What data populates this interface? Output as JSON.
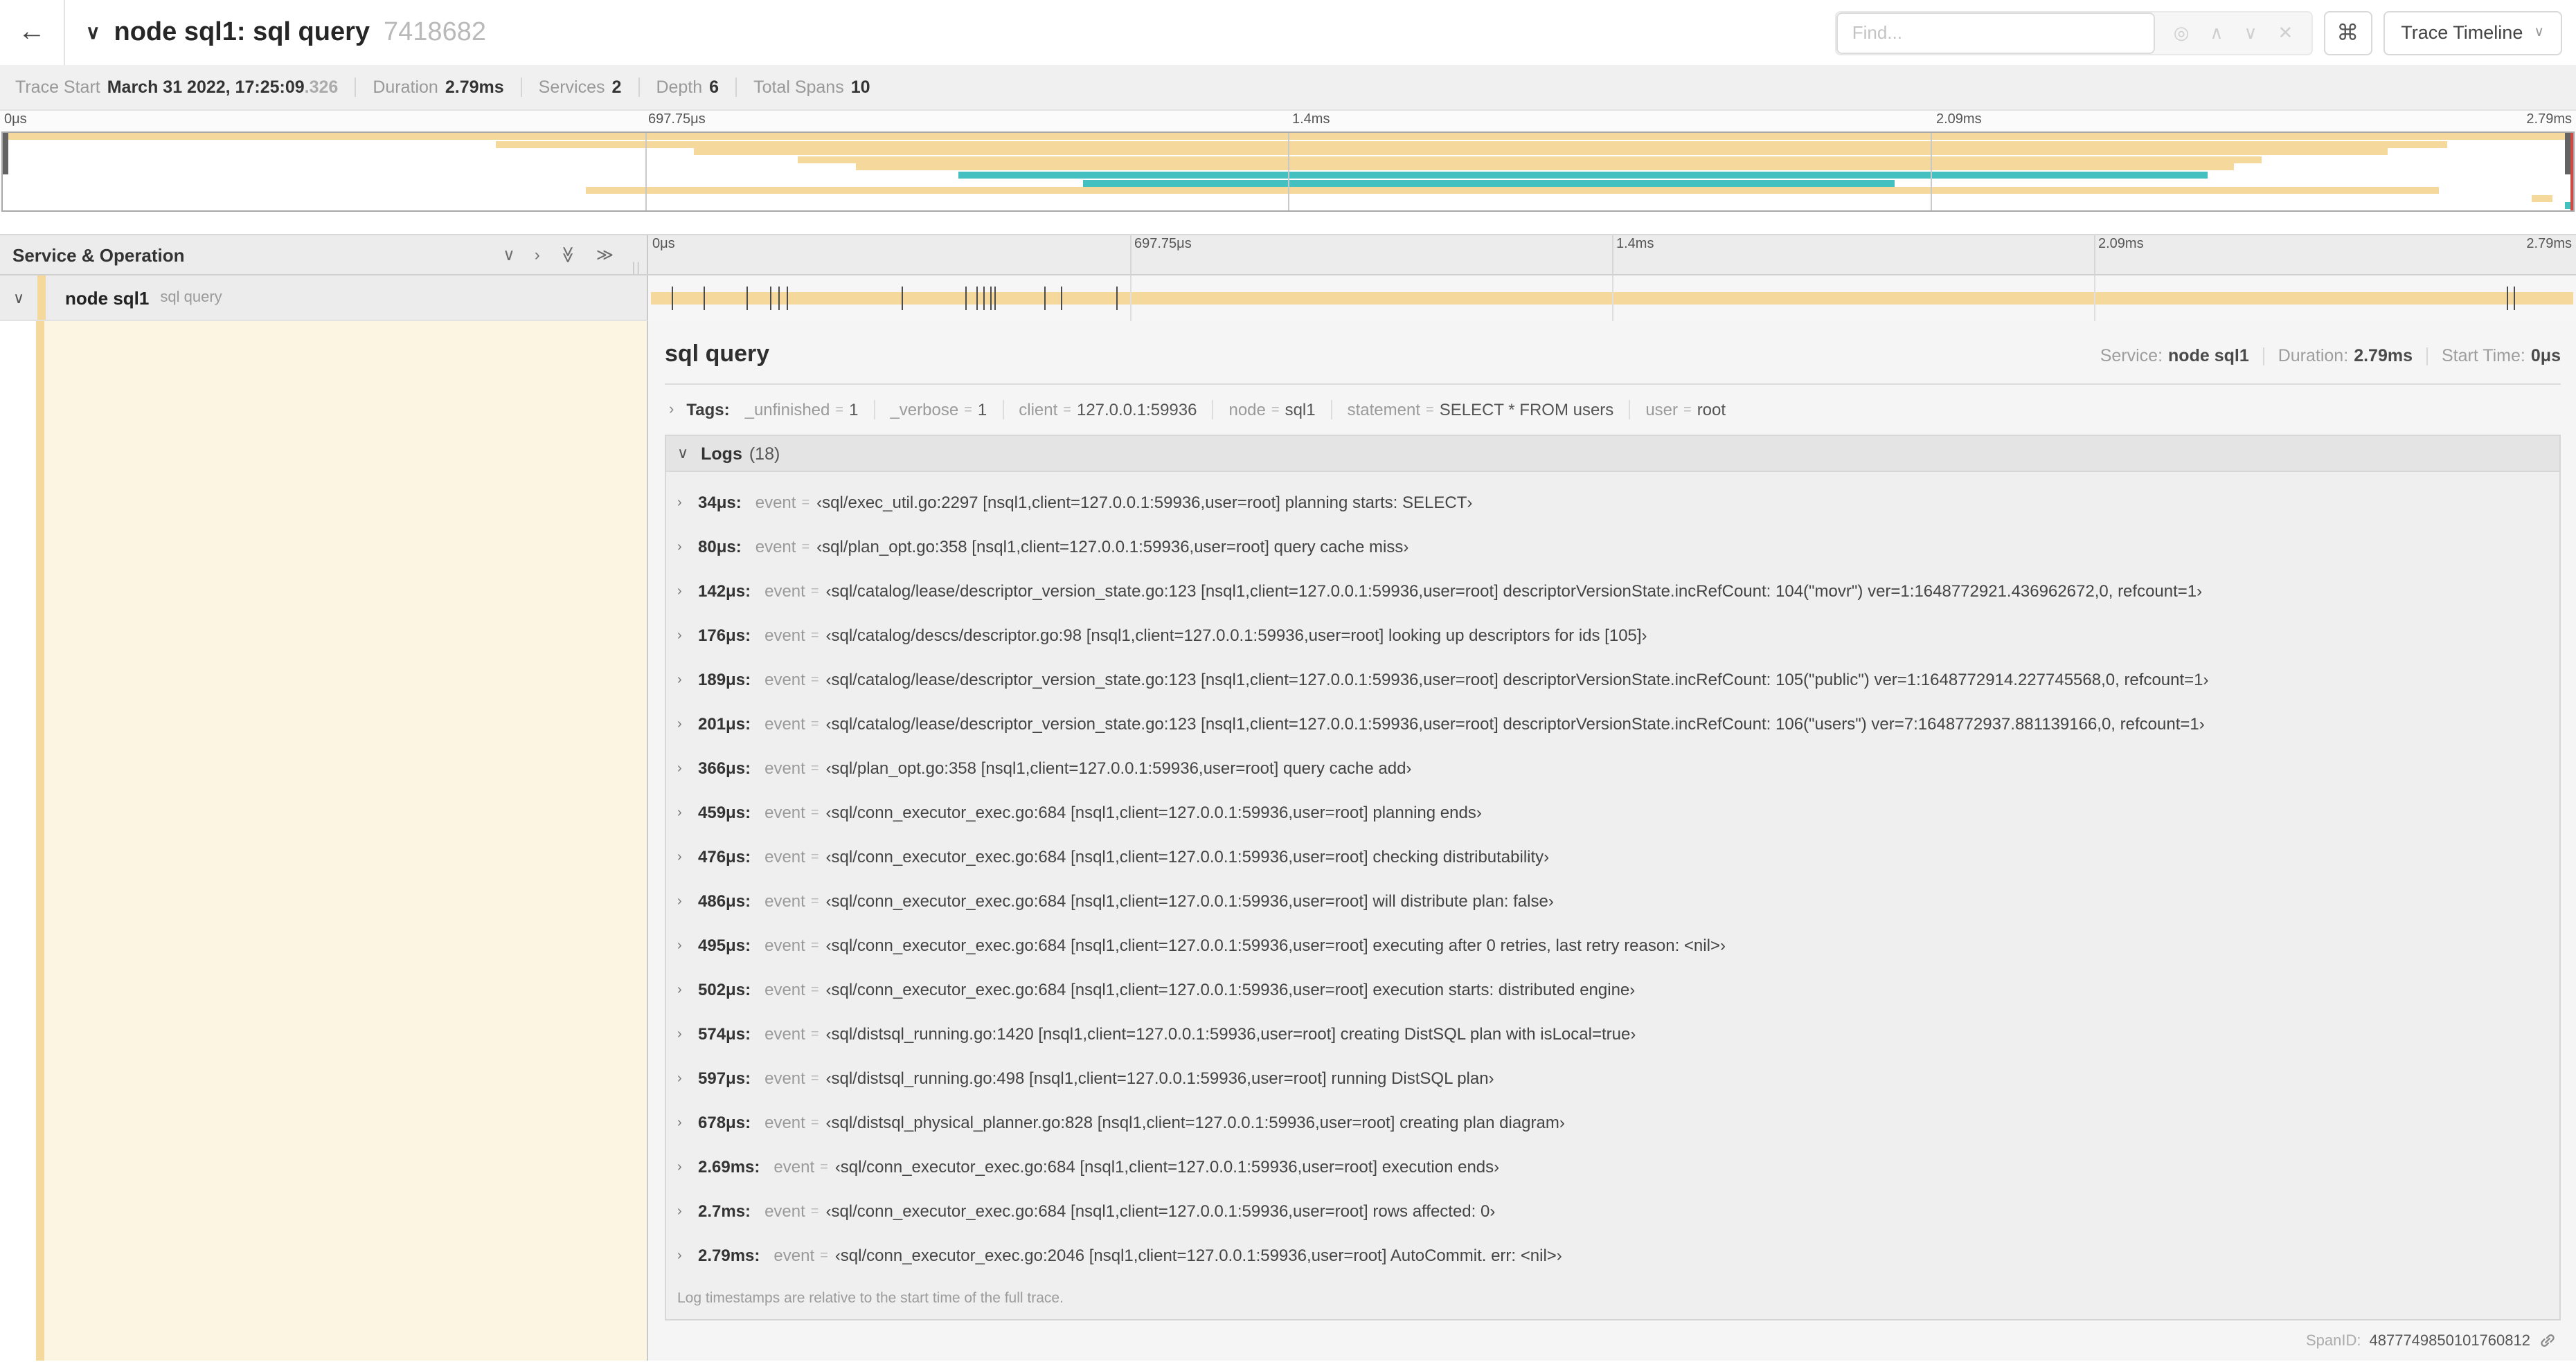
{
  "icons": {
    "back_arrow": "←",
    "chevron_down": "∨",
    "chevron_right": "›",
    "chevron_up": "∧",
    "double_chevron": "≫",
    "target": "◎",
    "close": "✕",
    "command": "⌘",
    "grip": "||"
  },
  "colors": {
    "span_tan": "#F5D99C",
    "span_teal": "#44C0C0",
    "detail_cream": "#FCF5E2",
    "minimap_end_marker": "#CF4A44"
  },
  "topbar": {
    "title": "node sql1: sql query",
    "trace_id_short": "7418682",
    "find_placeholder": "Find...",
    "view_button_label": "Trace Timeline"
  },
  "tracebar": {
    "items": [
      {
        "label": "Trace Start",
        "value": "March 31 2022, 17:25:09",
        "suffix": ".326"
      },
      {
        "label": "Duration",
        "value": "2.79ms"
      },
      {
        "label": "Services",
        "value": "2"
      },
      {
        "label": "Depth",
        "value": "6"
      },
      {
        "label": "Total Spans",
        "value": "10"
      }
    ]
  },
  "trace": {
    "duration_us": 2790
  },
  "ruler": {
    "ticks": [
      {
        "label": "0μs",
        "pct": 0
      },
      {
        "label": "697.75μs",
        "pct": 25
      },
      {
        "label": "1.4ms",
        "pct": 50
      },
      {
        "label": "2.09ms",
        "pct": 75
      },
      {
        "label": "2.79ms",
        "pct": 100
      }
    ],
    "grid_pcts": [
      25,
      50,
      75
    ]
  },
  "minimap": {
    "rows": [
      {
        "color": "tan",
        "start": 0,
        "end": 100
      },
      {
        "color": "tan",
        "start": 19.2,
        "end": 95.1
      },
      {
        "color": "tan",
        "start": 26.9,
        "end": 92.8
      },
      {
        "color": "tan",
        "start": 30.9,
        "end": 87.9
      },
      {
        "color": "tan",
        "start": 33.2,
        "end": 86.8
      },
      {
        "color": "teal",
        "start": 37.2,
        "end": 85.8
      },
      {
        "color": "teal",
        "start": 42.0,
        "end": 73.6
      },
      {
        "color": "tan",
        "start": 22.7,
        "end": 94.8
      },
      {
        "color": "tan",
        "start": 98.4,
        "end": 99.2
      },
      {
        "color": "teal",
        "start": 99.7,
        "end": 100
      }
    ]
  },
  "timeline_header": {
    "title": "Service & Operation"
  },
  "span_row": {
    "service": "node sql1",
    "operation": "sql query"
  },
  "detail": {
    "title": "sql query",
    "meta": [
      {
        "label": "Service:",
        "value": "node sql1"
      },
      {
        "label": "Duration:",
        "value": "2.79ms"
      },
      {
        "label": "Start Time:",
        "value": "0μs"
      }
    ],
    "tags": {
      "label": "Tags:",
      "items": [
        {
          "key": "_unfinished",
          "value": "1"
        },
        {
          "key": "_verbose",
          "value": "1"
        },
        {
          "key": "client",
          "value": "127.0.0.1:59936"
        },
        {
          "key": "node",
          "value": "sql1"
        },
        {
          "key": "statement",
          "value": "SELECT * FROM users"
        },
        {
          "key": "user",
          "value": "root"
        }
      ]
    },
    "logs": {
      "label": "Logs",
      "count": "(18)",
      "key_label": "event",
      "eq": "=",
      "rows": [
        {
          "time": "34μs:",
          "us": 34,
          "event": "‹sql/exec_util.go:2297 [nsql1,client=127.0.0.1:59936,user=root] planning starts: SELECT›"
        },
        {
          "time": "80μs:",
          "us": 80,
          "event": "‹sql/plan_opt.go:358 [nsql1,client=127.0.0.1:59936,user=root] query cache miss›"
        },
        {
          "time": "142μs:",
          "us": 142,
          "event": "‹sql/catalog/lease/descriptor_version_state.go:123 [nsql1,client=127.0.0.1:59936,user=root] descriptorVersionState.incRefCount: 104(\"movr\") ver=1:1648772921.436962672,0, refcount=1›"
        },
        {
          "time": "176μs:",
          "us": 176,
          "event": "‹sql/catalog/descs/descriptor.go:98 [nsql1,client=127.0.0.1:59936,user=root] looking up descriptors for ids [105]›"
        },
        {
          "time": "189μs:",
          "us": 189,
          "event": "‹sql/catalog/lease/descriptor_version_state.go:123 [nsql1,client=127.0.0.1:59936,user=root] descriptorVersionState.incRefCount: 105(\"public\") ver=1:1648772914.227745568,0, refcount=1›"
        },
        {
          "time": "201μs:",
          "us": 201,
          "event": "‹sql/catalog/lease/descriptor_version_state.go:123 [nsql1,client=127.0.0.1:59936,user=root] descriptorVersionState.incRefCount: 106(\"users\") ver=7:1648772937.881139166,0, refcount=1›"
        },
        {
          "time": "366μs:",
          "us": 366,
          "event": "‹sql/plan_opt.go:358 [nsql1,client=127.0.0.1:59936,user=root] query cache add›"
        },
        {
          "time": "459μs:",
          "us": 459,
          "event": "‹sql/conn_executor_exec.go:684 [nsql1,client=127.0.0.1:59936,user=root] planning ends›"
        },
        {
          "time": "476μs:",
          "us": 476,
          "event": "‹sql/conn_executor_exec.go:684 [nsql1,client=127.0.0.1:59936,user=root] checking distributability›"
        },
        {
          "time": "486μs:",
          "us": 486,
          "event": "‹sql/conn_executor_exec.go:684 [nsql1,client=127.0.0.1:59936,user=root] will distribute plan: false›"
        },
        {
          "time": "495μs:",
          "us": 495,
          "event": "‹sql/conn_executor_exec.go:684 [nsql1,client=127.0.0.1:59936,user=root] executing after 0 retries, last retry reason: <nil>›"
        },
        {
          "time": "502μs:",
          "us": 502,
          "event": "‹sql/conn_executor_exec.go:684 [nsql1,client=127.0.0.1:59936,user=root] execution starts: distributed engine›"
        },
        {
          "time": "574μs:",
          "us": 574,
          "event": "‹sql/distsql_running.go:1420 [nsql1,client=127.0.0.1:59936,user=root] creating DistSQL plan with isLocal=true›"
        },
        {
          "time": "597μs:",
          "us": 597,
          "event": "‹sql/distsql_running.go:498 [nsql1,client=127.0.0.1:59936,user=root] running DistSQL plan›"
        },
        {
          "time": "678μs:",
          "us": 678,
          "event": "‹sql/distsql_physical_planner.go:828 [nsql1,client=127.0.0.1:59936,user=root] creating plan diagram›"
        },
        {
          "time": "2.69ms:",
          "us": 2690,
          "event": "‹sql/conn_executor_exec.go:684 [nsql1,client=127.0.0.1:59936,user=root] execution ends›"
        },
        {
          "time": "2.7ms:",
          "us": 2700,
          "event": "‹sql/conn_executor_exec.go:684 [nsql1,client=127.0.0.1:59936,user=root] rows affected: 0›"
        },
        {
          "time": "2.79ms:",
          "us": 2790,
          "event": "‹sql/conn_executor_exec.go:2046 [nsql1,client=127.0.0.1:59936,user=root] AutoCommit. err: <nil>›"
        }
      ],
      "footer": "Log timestamps are relative to the start time of the full trace."
    },
    "span_id": {
      "label": "SpanID:",
      "value": "4877749850101760812"
    }
  }
}
